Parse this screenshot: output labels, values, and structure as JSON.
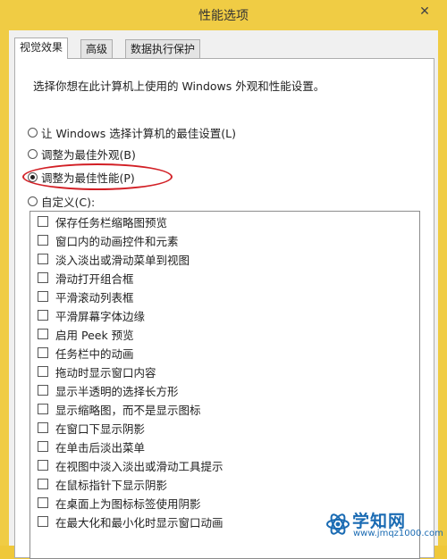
{
  "window": {
    "title": "性能选项",
    "close_glyph": "✕"
  },
  "tabs": [
    {
      "label": "视觉效果",
      "active": true
    },
    {
      "label": "高级",
      "active": false
    },
    {
      "label": "数据执行保护",
      "active": false
    }
  ],
  "panel": {
    "description": "选择你想在此计算机上使用的 Windows 外观和性能设置。",
    "options": [
      {
        "label": "让 Windows 选择计算机的最佳设置(L)",
        "checked": false
      },
      {
        "label": "调整为最佳外观(B)",
        "checked": false
      },
      {
        "label": "调整为最佳性能(P)",
        "checked": true
      },
      {
        "label": "自定义(C):",
        "checked": false
      }
    ],
    "checkboxes": [
      "保存任务栏缩略图预览",
      "窗口内的动画控件和元素",
      "淡入淡出或滑动菜单到视图",
      "滑动打开组合框",
      "平滑滚动列表框",
      "平滑屏幕字体边缘",
      "启用 Peek 预览",
      "任务栏中的动画",
      "拖动时显示窗口内容",
      "显示半透明的选择长方形",
      "显示缩略图，而不是显示图标",
      "在窗口下显示阴影",
      "在单击后淡出菜单",
      "在视图中淡入淡出或滑动工具提示",
      "在鼠标指针下显示阴影",
      "在桌面上为图标标签使用阴影",
      "在最大化和最小化时显示窗口动画"
    ]
  },
  "watermark": {
    "title": "学知网",
    "url": "www.jmqz1000.com"
  },
  "colors": {
    "accent_ellipse": "#d21f25",
    "titlebar": "#f0cc44",
    "watermark": "#1a6bb3"
  }
}
